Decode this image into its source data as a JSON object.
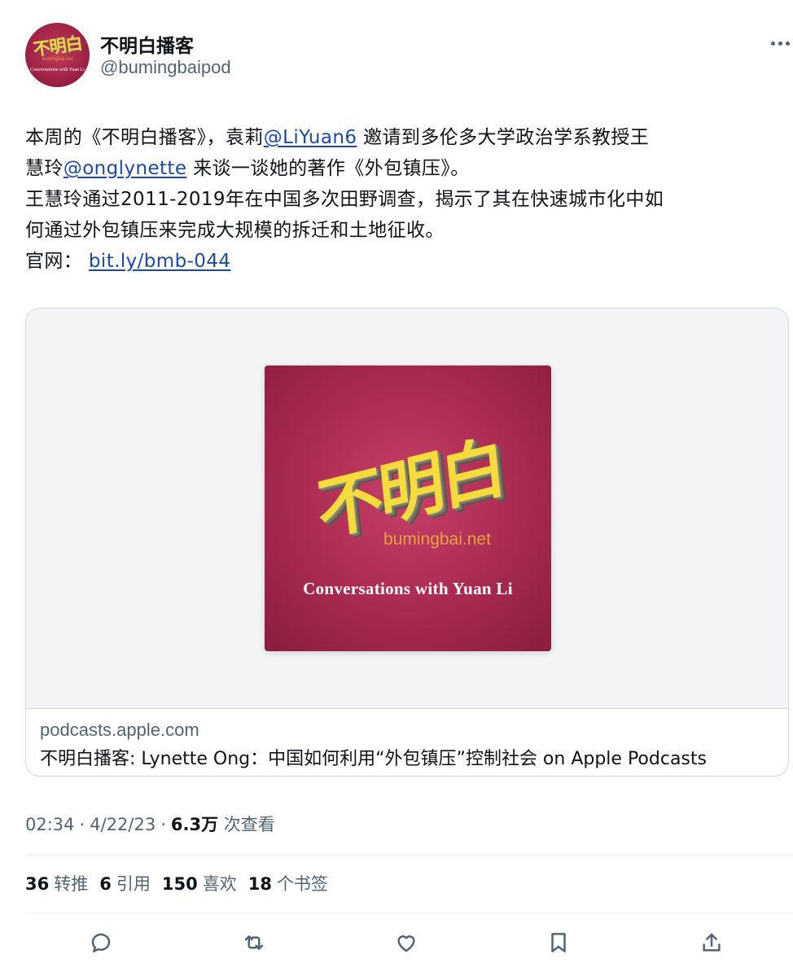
{
  "author": {
    "display_name": "不明白播客",
    "handle": "@bumingbaipod",
    "avatar": {
      "logo_text": "不明白",
      "site": "bumingbai.net",
      "tagline": "Conversations with Yuan Li"
    }
  },
  "tweet": {
    "lines": [
      [
        {
          "text": "本周的《不明白播客》，袁莉"
        },
        {
          "text": "@LiYuan6",
          "link": true
        },
        {
          "text": " 邀请到多伦多大学政治学系教授王"
        }
      ],
      [
        {
          "text": "慧玲"
        },
        {
          "text": "@onglynette",
          "link": true
        },
        {
          "text": " 来谈一谈她的著作《外包镇压》。"
        }
      ],
      [
        {
          "text": "王慧玲通过2011-2019年在中国多次田野调查，揭示了其在快速城市化中如"
        }
      ],
      [
        {
          "text": "何通过外包镇压来完成大规模的拆迁和土地征收。"
        }
      ],
      [
        {
          "text": "官网： "
        },
        {
          "text": "bit.ly/bmb-044",
          "link": true
        }
      ]
    ]
  },
  "card": {
    "cover": {
      "logo_text": "不明白",
      "site": "bumingbai.net",
      "tagline": "Conversations with Yuan Li"
    },
    "domain": "podcasts.apple.com",
    "title": "不明白播客: Lynette Ong：中国如何利用“外包镇压”控制社会 on Apple Podcasts"
  },
  "meta": {
    "time": "02:34",
    "date": "4/22/23",
    "views_count": "6.3万",
    "views_label": "次查看"
  },
  "stats": [
    {
      "count": "36",
      "label": "转推"
    },
    {
      "count": "6",
      "label": "引用"
    },
    {
      "count": "150",
      "label": "喜欢"
    },
    {
      "count": "18",
      "label": "个书签"
    }
  ],
  "actions": [
    {
      "name": "reply-icon"
    },
    {
      "name": "retweet-icon"
    },
    {
      "name": "like-icon"
    },
    {
      "name": "bookmark-icon"
    },
    {
      "name": "share-icon"
    }
  ],
  "colors": {
    "link": "#1d4a9c",
    "secondary_text": "#536471",
    "brand": "#a82a50",
    "logo_yellow": "#f5dc3c"
  }
}
